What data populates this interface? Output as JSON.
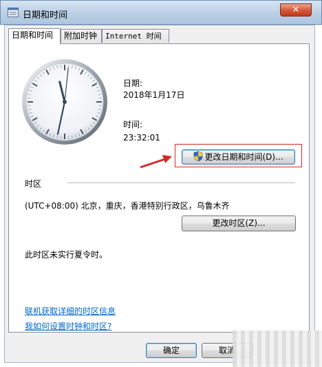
{
  "window": {
    "title": "日期和时间",
    "close_glyph": "✕"
  },
  "tabs": [
    {
      "label": "日期和时间",
      "active": true
    },
    {
      "label": "附加时钟",
      "active": false
    },
    {
      "label": "Internet 时间",
      "active": false
    }
  ],
  "clock": {
    "hour": 11,
    "minute": 32,
    "second": 1
  },
  "date": {
    "label": "日期:",
    "value": "2018年1月17日"
  },
  "time": {
    "label": "时间:",
    "value": "23:32:01"
  },
  "change_datetime_button": {
    "label": "更改日期和时间(D)...",
    "icon": "uac-shield-icon"
  },
  "timezone": {
    "section_label": "时区",
    "value": "(UTC+08:00) 北京，重庆，香港特别行政区，乌鲁木齐",
    "change_button": "更改时区(Z)...",
    "dst_note": "此时区未实行夏令时。"
  },
  "links": [
    "联机获取详细的时区信息",
    "我如何设置时钟和时区?"
  ],
  "footer": {
    "ok": "确定",
    "cancel": "取消"
  },
  "colors": {
    "annotation": "#d22a2a",
    "link": "#0066cc"
  }
}
